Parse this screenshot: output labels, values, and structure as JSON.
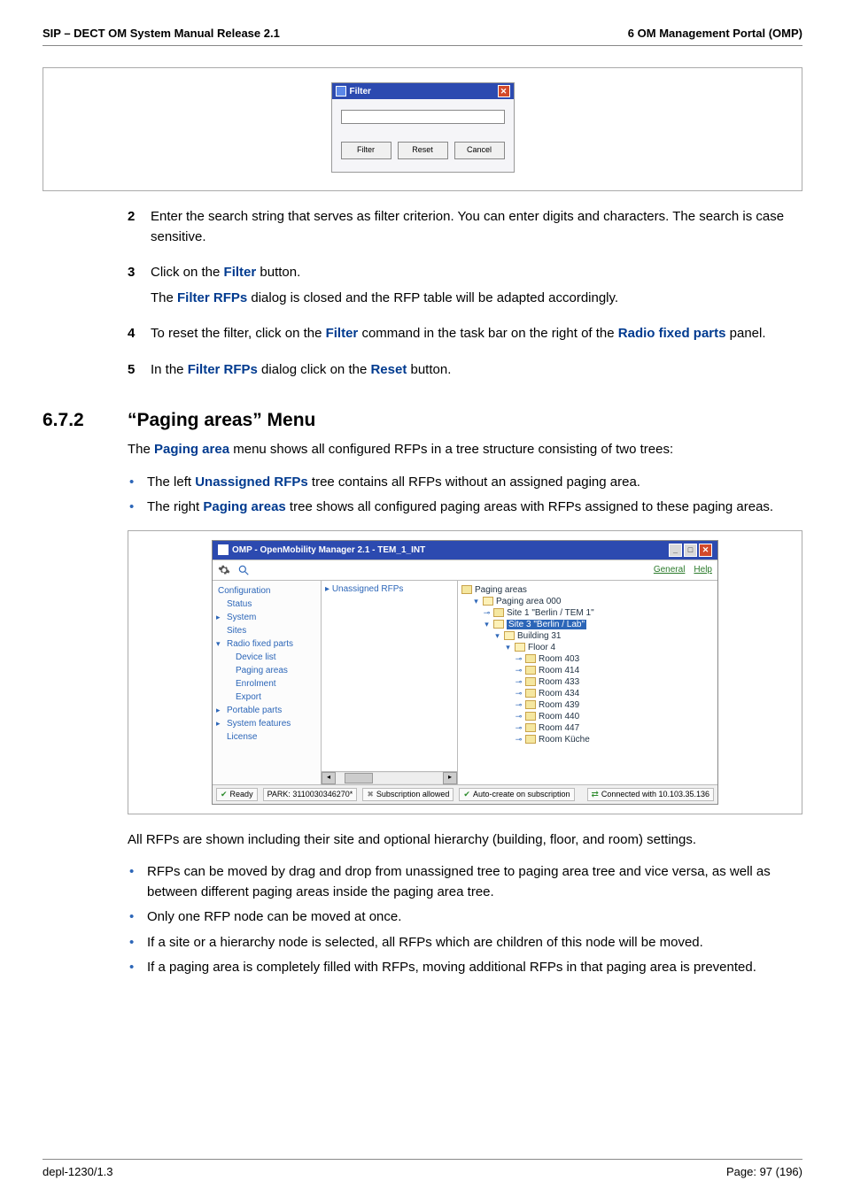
{
  "header": {
    "left": "SIP – DECT OM System Manual Release 2.1",
    "right": "6 OM Management Portal (OMP)"
  },
  "filter_dialog": {
    "title": "Filter",
    "btn_filter": "Filter",
    "btn_reset": "Reset",
    "btn_cancel": "Cancel"
  },
  "steps": [
    {
      "num": "2",
      "paras": [
        [
          {
            "t": "Enter the search string that serves as filter criterion. You can enter digits and characters. The search is case sensitive."
          }
        ]
      ]
    },
    {
      "num": "3",
      "paras": [
        [
          {
            "t": "Click on the "
          },
          {
            "t": "Filter",
            "e": true
          },
          {
            "t": " button."
          }
        ],
        [
          {
            "t": "The "
          },
          {
            "t": "Filter RFPs",
            "e": true
          },
          {
            "t": " dialog is closed and the RFP table will be adapted accordingly."
          }
        ]
      ]
    },
    {
      "num": "4",
      "paras": [
        [
          {
            "t": "To reset the filter, click on the "
          },
          {
            "t": "Filter",
            "e": true
          },
          {
            "t": " command in the task bar on the right of the "
          },
          {
            "t": "Radio fixed parts",
            "e": true
          },
          {
            "t": " panel."
          }
        ]
      ]
    },
    {
      "num": "5",
      "paras": [
        [
          {
            "t": "In the "
          },
          {
            "t": "Filter RFPs",
            "e": true
          },
          {
            "t": " dialog click on the "
          },
          {
            "t": "Reset",
            "e": true
          },
          {
            "t": " button."
          }
        ]
      ]
    }
  ],
  "section": {
    "number": "6.7.2",
    "title": "“Paging areas” Menu"
  },
  "intro_para": [
    {
      "t": "The "
    },
    {
      "t": "Paging area",
      "e": true
    },
    {
      "t": " menu shows all configured RFPs in a tree structure consisting of two trees:"
    }
  ],
  "intro_bullets": [
    [
      {
        "t": "The left "
      },
      {
        "t": "Unassigned RFPs",
        "e": true
      },
      {
        "t": " tree contains all RFPs without an assigned paging area."
      }
    ],
    [
      {
        "t": "The right "
      },
      {
        "t": "Paging areas",
        "e": true
      },
      {
        "t": " tree shows all configured paging areas with RFPs assigned to these paging areas."
      }
    ]
  ],
  "omp": {
    "title": "OMP - OpenMobility Manager 2.1 - TEM_1_INT",
    "menu_general": "General",
    "menu_help": "Help",
    "sidebar": [
      {
        "label": "Configuration",
        "class": "top"
      },
      {
        "label": "Status",
        "class": ""
      },
      {
        "label": "System",
        "class": "arrow"
      },
      {
        "label": "Sites",
        "class": ""
      },
      {
        "label": "Radio fixed parts",
        "class": "arrow-down"
      },
      {
        "label": "Device list",
        "class": "sub"
      },
      {
        "label": "Paging areas",
        "class": "sub selected"
      },
      {
        "label": "Enrolment",
        "class": "sub"
      },
      {
        "label": "Export",
        "class": "sub"
      },
      {
        "label": "Portable parts",
        "class": "arrow"
      },
      {
        "label": "System features",
        "class": "arrow"
      },
      {
        "label": "License",
        "class": ""
      }
    ],
    "center_title": "Unassigned RFPs",
    "tree_root": "Paging areas",
    "tree": [
      {
        "lvl": 1,
        "exp": "▾",
        "open": true,
        "label": "Paging area 000"
      },
      {
        "lvl": 2,
        "exp": "⊸",
        "open": false,
        "label": "Site 1 \"Berlin / TEM 1\""
      },
      {
        "lvl": 2,
        "exp": "▾",
        "open": true,
        "label": "Site 3 \"Berlin / Lab\"",
        "sel": true
      },
      {
        "lvl": 3,
        "exp": "▾",
        "open": true,
        "label": "Building 31"
      },
      {
        "lvl": 4,
        "exp": "▾",
        "open": true,
        "label": "Floor 4"
      },
      {
        "lvl": 5,
        "exp": "⊸",
        "open": false,
        "label": "Room 403"
      },
      {
        "lvl": 5,
        "exp": "⊸",
        "open": false,
        "label": "Room 414"
      },
      {
        "lvl": 5,
        "exp": "⊸",
        "open": false,
        "label": "Room 433"
      },
      {
        "lvl": 5,
        "exp": "⊸",
        "open": false,
        "label": "Room 434"
      },
      {
        "lvl": 5,
        "exp": "⊸",
        "open": false,
        "label": "Room 439"
      },
      {
        "lvl": 5,
        "exp": "⊸",
        "open": false,
        "label": "Room 440"
      },
      {
        "lvl": 5,
        "exp": "⊸",
        "open": false,
        "label": "Room 447"
      },
      {
        "lvl": 5,
        "exp": "⊸",
        "open": false,
        "label": "Room Küche"
      }
    ],
    "status": {
      "ready": "Ready",
      "park": "PARK: 3110030346270*",
      "subscription": "Subscription allowed",
      "autocreate": "Auto-create on subscription",
      "connected": "Connected with 10.103.35.136"
    }
  },
  "post_para": "All RFPs are shown including their site and optional hierarchy (building, floor, and room) settings.",
  "post_bullets": [
    "RFPs can be moved by drag and drop from unassigned tree to paging area tree and vice versa, as well as between different paging areas inside the paging area tree.",
    "Only one RFP node can be moved at once.",
    "If a site or a hierarchy node is selected, all RFPs which are children of this node will be moved.",
    "If a paging area is completely filled with RFPs, moving additional RFPs in that paging area is prevented."
  ],
  "footer": {
    "left": "depl-1230/1.3",
    "right": "Page: 97 (196)"
  }
}
